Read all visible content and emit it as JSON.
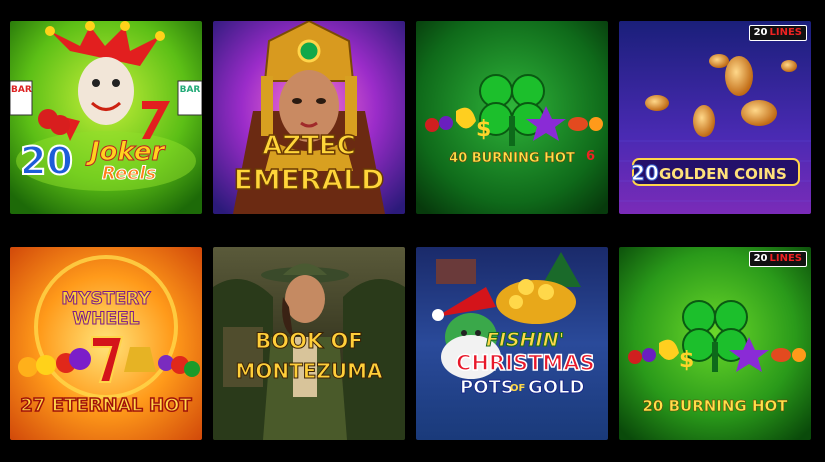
{
  "games": [
    {
      "id": "joker",
      "line1": "20",
      "line2": "Joker",
      "line3": "Reels",
      "bar": "BAR"
    },
    {
      "id": "aztec",
      "line1": "AZTEC",
      "line2": "EMERALD"
    },
    {
      "id": "burning40",
      "line1": "40 BURNING HOT",
      "line2": "6"
    },
    {
      "id": "golden",
      "line1": "20",
      "line2": "GOLDEN COINS",
      "badge_num": "20",
      "badge_lines": "LINES"
    },
    {
      "id": "mystery",
      "line1": "MYSTERY",
      "line2": "WHEEL",
      "line3": "27 ETERNAL HOT",
      "seven": "7"
    },
    {
      "id": "montezuma",
      "line1": "BOOK OF",
      "line2": "MONTEZUMA"
    },
    {
      "id": "fishin",
      "line1": "FISHIN'",
      "line2": "CHRISTMAS",
      "line3": "POTS",
      "line4": "OF",
      "line5": "GOLD"
    },
    {
      "id": "burning20",
      "line1": "20 BURNING HOT",
      "badge_num": "20",
      "badge_lines": "LINES"
    }
  ]
}
